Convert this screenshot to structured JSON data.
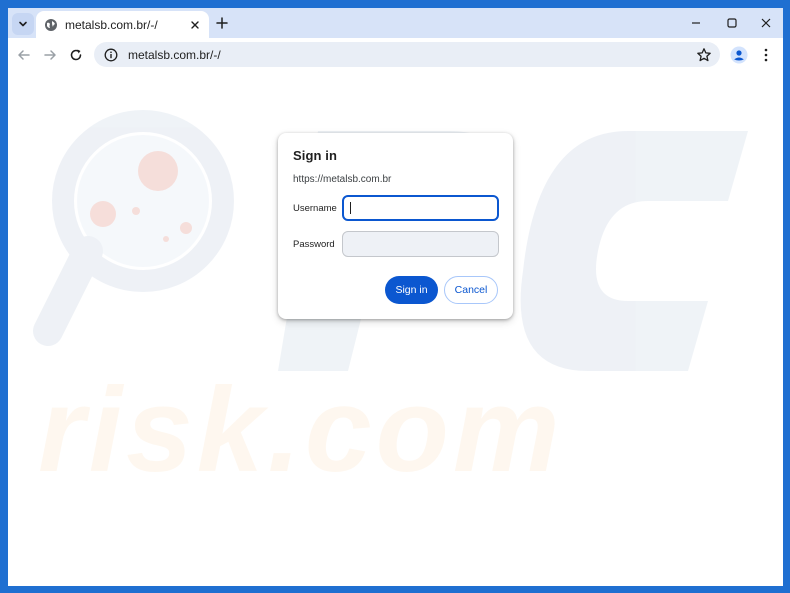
{
  "tab": {
    "title": "metalsb.com.br/-/"
  },
  "omnibox": {
    "url": "metalsb.com.br/-/"
  },
  "dialog": {
    "heading": "Sign in",
    "origin": "https://metalsb.com.br",
    "username_label": "Username",
    "password_label": "Password",
    "username_value": "",
    "password_value": "",
    "sign_in_label": "Sign in",
    "cancel_label": "Cancel"
  },
  "watermark": {
    "logo_text": "PC",
    "brand_text": "risk.com"
  },
  "colors": {
    "window_frame": "#1f6fd1",
    "tabstrip": "#d7e3f8",
    "accent": "#0b57d0"
  },
  "icons": {
    "tab_search": "chevron-down-icon",
    "favicon": "globe-icon",
    "tab_close": "close-icon",
    "new_tab": "plus-icon",
    "minimize": "minimize-icon",
    "maximize": "maximize-icon",
    "close_window": "close-icon",
    "back": "arrow-left-icon",
    "forward": "arrow-right-icon",
    "reload": "reload-icon",
    "site_info": "info-icon",
    "bookmark": "star-icon",
    "profile": "person-icon",
    "menu": "kebab-menu-icon"
  }
}
